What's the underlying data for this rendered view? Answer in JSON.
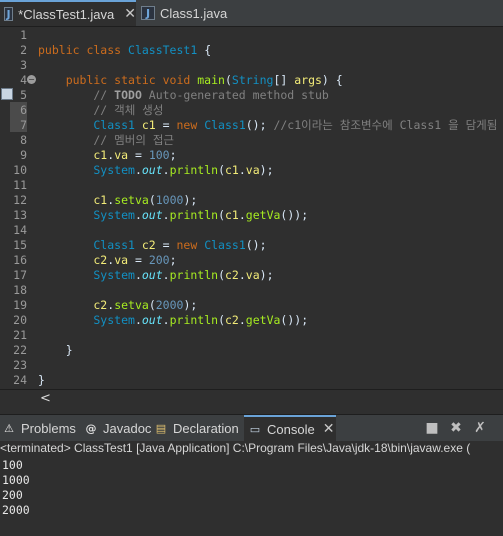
{
  "tabs": [
    {
      "label": "*ClassTest1.java",
      "icon": "java-file-icon"
    },
    {
      "label": "Class1.java",
      "icon": "java-file-icon"
    }
  ],
  "editor": {
    "lines": [
      {
        "n": "1",
        "c": []
      },
      {
        "n": "2",
        "c": [
          [
            "kw",
            "public class "
          ],
          [
            "ty",
            "ClassTest1"
          ],
          [
            "plain",
            " {"
          ]
        ]
      },
      {
        "n": "3",
        "c": []
      },
      {
        "n": "4",
        "c": [
          [
            "kw",
            "    public static void "
          ],
          [
            "fn",
            "main"
          ],
          [
            "plain",
            "("
          ],
          [
            "ty",
            "String"
          ],
          [
            "plain",
            "[] "
          ],
          [
            "va",
            "args"
          ],
          [
            "plain",
            ") {"
          ]
        ]
      },
      {
        "n": "5",
        "c": [
          [
            "cm",
            "        // "
          ],
          [
            "cmb",
            "TODO"
          ],
          [
            "cm",
            " Auto-generated method stub"
          ]
        ]
      },
      {
        "n": "6",
        "c": [
          [
            "cm",
            "        // 객체 생성"
          ]
        ]
      },
      {
        "n": "7",
        "c": [
          [
            "ty",
            "        Class1 "
          ],
          [
            "va",
            "c1"
          ],
          [
            "plain",
            " = "
          ],
          [
            "kw",
            "new "
          ],
          [
            "ty",
            "Class1"
          ],
          [
            "plain",
            "(); "
          ],
          [
            "cm",
            "//c1이라는 참조변수에 Class1 을 담게됨"
          ]
        ]
      },
      {
        "n": "8",
        "c": [
          [
            "cm",
            "        // 멤버의 접근"
          ]
        ]
      },
      {
        "n": "9",
        "c": [
          [
            "va",
            "        c1"
          ],
          [
            "plain",
            "."
          ],
          [
            "va",
            "va"
          ],
          [
            "plain",
            " = "
          ],
          [
            "num",
            "100"
          ],
          [
            "plain",
            ";"
          ]
        ]
      },
      {
        "n": "10",
        "c": [
          [
            "ty",
            "        System"
          ],
          [
            "plain",
            "."
          ],
          [
            "fld",
            "out"
          ],
          [
            "plain",
            "."
          ],
          [
            "fn",
            "println"
          ],
          [
            "plain",
            "("
          ],
          [
            "va",
            "c1"
          ],
          [
            "plain",
            "."
          ],
          [
            "va",
            "va"
          ],
          [
            "plain",
            ");"
          ]
        ]
      },
      {
        "n": "11",
        "c": []
      },
      {
        "n": "12",
        "c": [
          [
            "va",
            "        c1"
          ],
          [
            "plain",
            "."
          ],
          [
            "fn",
            "setva"
          ],
          [
            "plain",
            "("
          ],
          [
            "num",
            "1000"
          ],
          [
            "plain",
            ");"
          ]
        ]
      },
      {
        "n": "13",
        "c": [
          [
            "ty",
            "        System"
          ],
          [
            "plain",
            "."
          ],
          [
            "fld",
            "out"
          ],
          [
            "plain",
            "."
          ],
          [
            "fn",
            "println"
          ],
          [
            "plain",
            "("
          ],
          [
            "va",
            "c1"
          ],
          [
            "plain",
            "."
          ],
          [
            "fn",
            "getVa"
          ],
          [
            "plain",
            "());"
          ]
        ]
      },
      {
        "n": "14",
        "c": []
      },
      {
        "n": "15",
        "c": [
          [
            "ty",
            "        Class1 "
          ],
          [
            "va",
            "c2"
          ],
          [
            "plain",
            " = "
          ],
          [
            "kw",
            "new "
          ],
          [
            "ty",
            "Class1"
          ],
          [
            "plain",
            "();"
          ]
        ]
      },
      {
        "n": "16",
        "c": [
          [
            "va",
            "        c2"
          ],
          [
            "plain",
            "."
          ],
          [
            "va",
            "va"
          ],
          [
            "plain",
            " = "
          ],
          [
            "num",
            "200"
          ],
          [
            "plain",
            ";"
          ]
        ]
      },
      {
        "n": "17",
        "c": [
          [
            "ty",
            "        System"
          ],
          [
            "plain",
            "."
          ],
          [
            "fld",
            "out"
          ],
          [
            "plain",
            "."
          ],
          [
            "fn",
            "println"
          ],
          [
            "plain",
            "("
          ],
          [
            "va",
            "c2"
          ],
          [
            "plain",
            "."
          ],
          [
            "va",
            "va"
          ],
          [
            "plain",
            ");"
          ]
        ]
      },
      {
        "n": "18",
        "c": []
      },
      {
        "n": "19",
        "c": [
          [
            "va",
            "        c2"
          ],
          [
            "plain",
            "."
          ],
          [
            "fn",
            "setva"
          ],
          [
            "plain",
            "("
          ],
          [
            "num",
            "2000"
          ],
          [
            "plain",
            ");"
          ]
        ]
      },
      {
        "n": "20",
        "c": [
          [
            "ty",
            "        System"
          ],
          [
            "plain",
            "."
          ],
          [
            "fld",
            "out"
          ],
          [
            "plain",
            "."
          ],
          [
            "fn",
            "println"
          ],
          [
            "plain",
            "("
          ],
          [
            "va",
            "c2"
          ],
          [
            "plain",
            "."
          ],
          [
            "fn",
            "getVa"
          ],
          [
            "plain",
            "());"
          ]
        ]
      },
      {
        "n": "21",
        "c": []
      },
      {
        "n": "22",
        "c": [
          [
            "plain",
            "    }"
          ]
        ]
      },
      {
        "n": "23",
        "c": []
      },
      {
        "n": "24",
        "c": [
          [
            "plain",
            "}"
          ]
        ]
      }
    ]
  },
  "panel": {
    "tabs": [
      {
        "label": "Problems",
        "icon": "problems-icon"
      },
      {
        "label": "Javadoc",
        "icon": "javadoc-icon"
      },
      {
        "label": "Declaration",
        "icon": "declaration-icon"
      },
      {
        "label": "Console",
        "icon": "console-icon"
      }
    ],
    "status": "<terminated> ClassTest1 [Java Application] C:\\Program Files\\Java\\jdk-18\\bin\\javaw.exe  (",
    "output": [
      "100",
      "1000",
      "200",
      "2000"
    ]
  },
  "colors": {
    "accent": "#6aa3d8",
    "background": "#2f2f2f"
  }
}
